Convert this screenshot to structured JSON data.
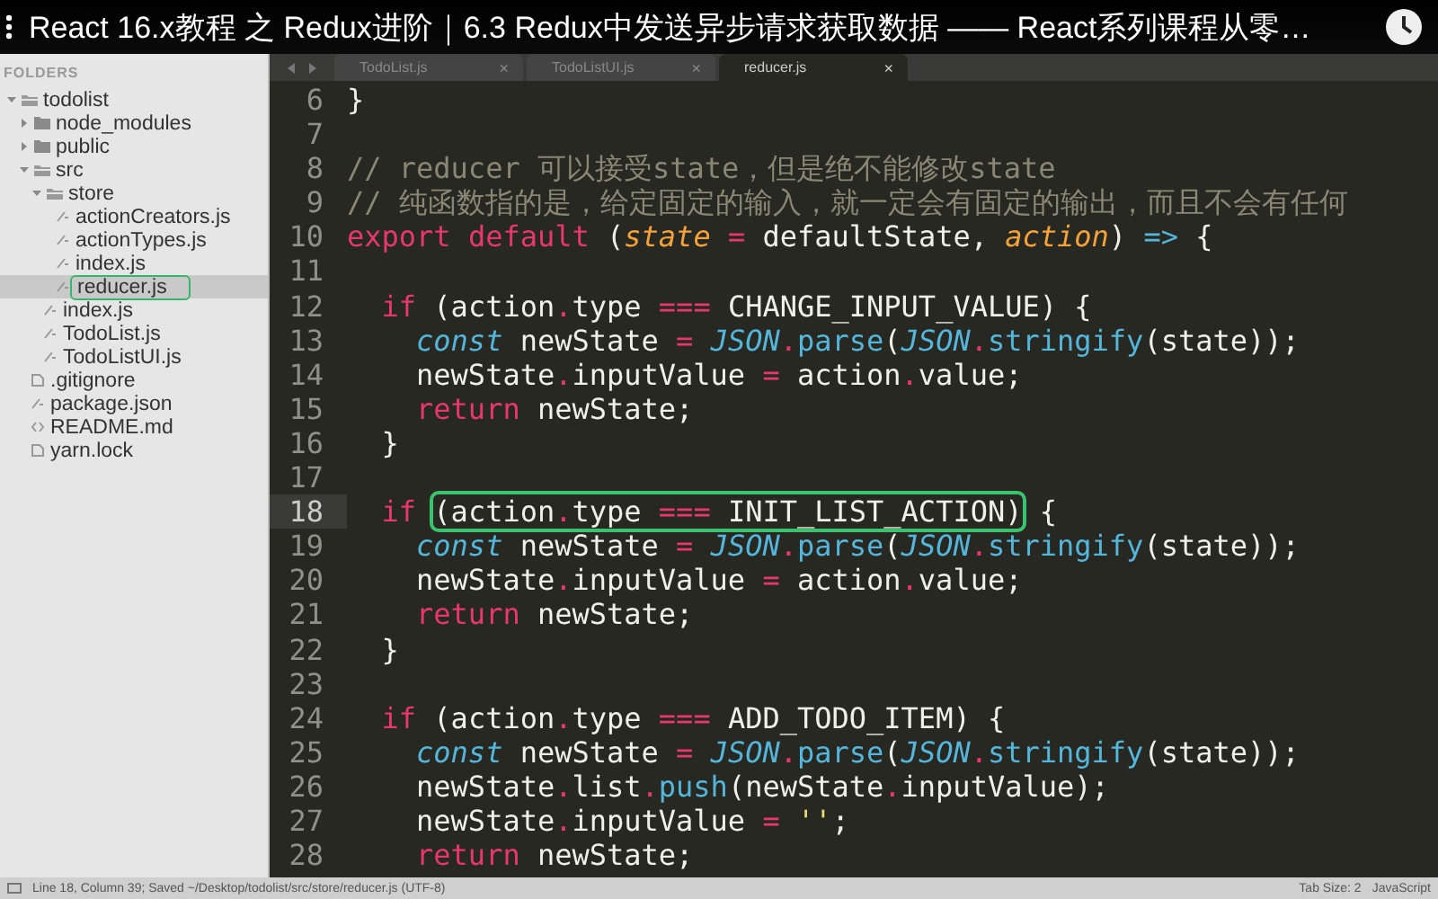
{
  "video_title": "React 16.x教程 之 Redux进阶｜6.3 Redux中发送异步请求获取数据 —— React系列课程从零…",
  "sidebar": {
    "header": "FOLDERS",
    "tree": [
      {
        "name": "todolist",
        "kind": "folder",
        "expanded": true,
        "selected": false,
        "children": [
          {
            "name": "node_modules",
            "kind": "folder",
            "expanded": false,
            "selected": false
          },
          {
            "name": "public",
            "kind": "folder",
            "expanded": false,
            "selected": false
          },
          {
            "name": "src",
            "kind": "folder",
            "expanded": true,
            "selected": false,
            "children": [
              {
                "name": "store",
                "kind": "folder",
                "expanded": true,
                "selected": false,
                "children": [
                  {
                    "name": "actionCreators.js",
                    "kind": "script",
                    "selected": false
                  },
                  {
                    "name": "actionTypes.js",
                    "kind": "script",
                    "selected": false
                  },
                  {
                    "name": "index.js",
                    "kind": "script",
                    "selected": false
                  },
                  {
                    "name": "reducer.js",
                    "kind": "script",
                    "selected": true,
                    "annotated": true
                  }
                ]
              },
              {
                "name": "index.js",
                "kind": "script",
                "selected": false
              },
              {
                "name": "TodoList.js",
                "kind": "script",
                "selected": false
              },
              {
                "name": "TodoListUI.js",
                "kind": "script",
                "selected": false
              }
            ]
          },
          {
            "name": ".gitignore",
            "kind": "file",
            "selected": false
          },
          {
            "name": "package.json",
            "kind": "script",
            "selected": false
          },
          {
            "name": "README.md",
            "kind": "markup",
            "selected": false
          },
          {
            "name": "yarn.lock",
            "kind": "file",
            "selected": false
          }
        ]
      }
    ]
  },
  "tabs": [
    {
      "label": "TodoList.js",
      "close": "×",
      "selected": false
    },
    {
      "label": "TodoListUI.js",
      "close": "×",
      "selected": false
    },
    {
      "label": "reducer.js",
      "close": "×",
      "selected": true
    }
  ],
  "code": [
    {
      "number": "6",
      "current": false,
      "tokens": [
        {
          "text": "}",
          "kind": "plain"
        }
      ]
    },
    {
      "number": "7",
      "current": false
    },
    {
      "number": "8",
      "current": false,
      "tokens": [
        {
          "text": "// reducer 可以接受state，但是绝不能修改state",
          "kind": "comment"
        }
      ]
    },
    {
      "number": "9",
      "current": false,
      "tokens": [
        {
          "text": "// 纯函数指的是，给定固定的输入，就一定会有固定的输出，而且不会有任何",
          "kind": "comment"
        }
      ]
    },
    {
      "number": "10",
      "current": false,
      "tokens": [
        {
          "text": "export ",
          "kind": "keyword"
        },
        {
          "text": "default",
          "kind": "keyword"
        },
        {
          "text": " (",
          "kind": "plain"
        },
        {
          "text": "state ",
          "kind": "param"
        },
        {
          "text": "=",
          "kind": "operator"
        },
        {
          "text": " defaultState, ",
          "kind": "plain"
        },
        {
          "text": "action",
          "kind": "param"
        },
        {
          "text": ") ",
          "kind": "plain"
        },
        {
          "text": "=>",
          "kind": "function"
        },
        {
          "text": " {",
          "kind": "plain"
        }
      ]
    },
    {
      "number": "11",
      "current": false
    },
    {
      "number": "12",
      "current": false,
      "tokens": [
        {
          "text": "  if",
          "kind": "keyword"
        },
        {
          "text": " (action",
          "kind": "plain"
        },
        {
          "text": ".",
          "kind": "operator"
        },
        {
          "text": "type ",
          "kind": "plain"
        },
        {
          "text": "===",
          "kind": "operator"
        },
        {
          "text": " CHANGE_INPUT_VALUE) {",
          "kind": "plain"
        }
      ]
    },
    {
      "number": "13",
      "current": false,
      "tokens": [
        {
          "text": "    const",
          "kind": "storage"
        },
        {
          "text": " newState ",
          "kind": "plain"
        },
        {
          "text": "= ",
          "kind": "operator"
        },
        {
          "text": "JSON",
          "kind": "storage"
        },
        {
          "text": ".",
          "kind": "operator"
        },
        {
          "text": "parse",
          "kind": "function"
        },
        {
          "text": "(",
          "kind": "plain"
        },
        {
          "text": "JSON",
          "kind": "storage"
        },
        {
          "text": ".",
          "kind": "operator"
        },
        {
          "text": "stringify",
          "kind": "function"
        },
        {
          "text": "(state));",
          "kind": "plain"
        }
      ]
    },
    {
      "number": "14",
      "current": false,
      "tokens": [
        {
          "text": "    newState",
          "kind": "plain"
        },
        {
          "text": ".",
          "kind": "operator"
        },
        {
          "text": "inputValue ",
          "kind": "plain"
        },
        {
          "text": "=",
          "kind": "operator"
        },
        {
          "text": " action",
          "kind": "plain"
        },
        {
          "text": ".",
          "kind": "operator"
        },
        {
          "text": "value;",
          "kind": "plain"
        }
      ]
    },
    {
      "number": "15",
      "current": false,
      "tokens": [
        {
          "text": "    return",
          "kind": "keyword"
        },
        {
          "text": " newState;",
          "kind": "plain"
        }
      ]
    },
    {
      "number": "16",
      "current": false,
      "tokens": [
        {
          "text": "  }",
          "kind": "plain"
        }
      ]
    },
    {
      "number": "17",
      "current": false
    },
    {
      "number": "18",
      "current": true,
      "tokens": [
        {
          "text": "  if ",
          "kind": "keyword"
        },
        {
          "text": "(action",
          "kind": "plain",
          "boxed": true
        },
        {
          "text": ".",
          "kind": "operator",
          "boxed": true
        },
        {
          "text": "type ",
          "kind": "plain",
          "boxed": true
        },
        {
          "text": "===",
          "kind": "operator",
          "boxed": true
        },
        {
          "text": " INIT_LIST_ACTION)",
          "kind": "plain",
          "boxed": true
        },
        {
          "text": " {",
          "kind": "plain"
        }
      ]
    },
    {
      "number": "19",
      "current": false,
      "tokens": [
        {
          "text": "    const",
          "kind": "storage"
        },
        {
          "text": " newState ",
          "kind": "plain"
        },
        {
          "text": "= ",
          "kind": "operator"
        },
        {
          "text": "JSON",
          "kind": "storage"
        },
        {
          "text": ".",
          "kind": "operator"
        },
        {
          "text": "parse",
          "kind": "function"
        },
        {
          "text": "(",
          "kind": "plain"
        },
        {
          "text": "JSON",
          "kind": "storage"
        },
        {
          "text": ".",
          "kind": "operator"
        },
        {
          "text": "stringify",
          "kind": "function"
        },
        {
          "text": "(state));",
          "kind": "plain"
        }
      ]
    },
    {
      "number": "20",
      "current": false,
      "tokens": [
        {
          "text": "    newState",
          "kind": "plain"
        },
        {
          "text": ".",
          "kind": "operator"
        },
        {
          "text": "inputValue ",
          "kind": "plain"
        },
        {
          "text": "=",
          "kind": "operator"
        },
        {
          "text": " action",
          "kind": "plain"
        },
        {
          "text": ".",
          "kind": "operator"
        },
        {
          "text": "value;",
          "kind": "plain"
        }
      ]
    },
    {
      "number": "21",
      "current": false,
      "tokens": [
        {
          "text": "    return",
          "kind": "keyword"
        },
        {
          "text": " newState;",
          "kind": "plain"
        }
      ]
    },
    {
      "number": "22",
      "current": false,
      "tokens": [
        {
          "text": "  }",
          "kind": "plain"
        }
      ]
    },
    {
      "number": "23",
      "current": false
    },
    {
      "number": "24",
      "current": false,
      "tokens": [
        {
          "text": "  if",
          "kind": "keyword"
        },
        {
          "text": " (action",
          "kind": "plain"
        },
        {
          "text": ".",
          "kind": "operator"
        },
        {
          "text": "type ",
          "kind": "plain"
        },
        {
          "text": "===",
          "kind": "operator"
        },
        {
          "text": " ADD_TODO_ITEM) {",
          "kind": "plain"
        }
      ]
    },
    {
      "number": "25",
      "current": false,
      "tokens": [
        {
          "text": "    const",
          "kind": "storage"
        },
        {
          "text": " newState ",
          "kind": "plain"
        },
        {
          "text": "= ",
          "kind": "operator"
        },
        {
          "text": "JSON",
          "kind": "storage"
        },
        {
          "text": ".",
          "kind": "operator"
        },
        {
          "text": "parse",
          "kind": "function"
        },
        {
          "text": "(",
          "kind": "plain"
        },
        {
          "text": "JSON",
          "kind": "storage"
        },
        {
          "text": ".",
          "kind": "operator"
        },
        {
          "text": "stringify",
          "kind": "function"
        },
        {
          "text": "(state));",
          "kind": "plain"
        }
      ]
    },
    {
      "number": "26",
      "current": false,
      "tokens": [
        {
          "text": "    newState",
          "kind": "plain"
        },
        {
          "text": ".",
          "kind": "operator"
        },
        {
          "text": "list",
          "kind": "plain"
        },
        {
          "text": ".",
          "kind": "operator"
        },
        {
          "text": "push",
          "kind": "function"
        },
        {
          "text": "(newState",
          "kind": "plain"
        },
        {
          "text": ".",
          "kind": "operator"
        },
        {
          "text": "inputValue);",
          "kind": "plain"
        }
      ]
    },
    {
      "number": "27",
      "current": false,
      "tokens": [
        {
          "text": "    newState",
          "kind": "plain"
        },
        {
          "text": ".",
          "kind": "operator"
        },
        {
          "text": "inputValue ",
          "kind": "plain"
        },
        {
          "text": "= ",
          "kind": "operator"
        },
        {
          "text": "''",
          "kind": "string"
        },
        {
          "text": ";",
          "kind": "plain"
        }
      ]
    },
    {
      "number": "28",
      "current": false,
      "tokens": [
        {
          "text": "    return",
          "kind": "keyword"
        },
        {
          "text": " newState;",
          "kind": "plain"
        }
      ]
    }
  ],
  "status_bar": {
    "position": "Line 18, Column 39; Saved ~/Desktop/todolist/src/store/reducer.js (UTF-8)",
    "tab_size": "Tab Size: 2",
    "syntax": "JavaScript"
  }
}
